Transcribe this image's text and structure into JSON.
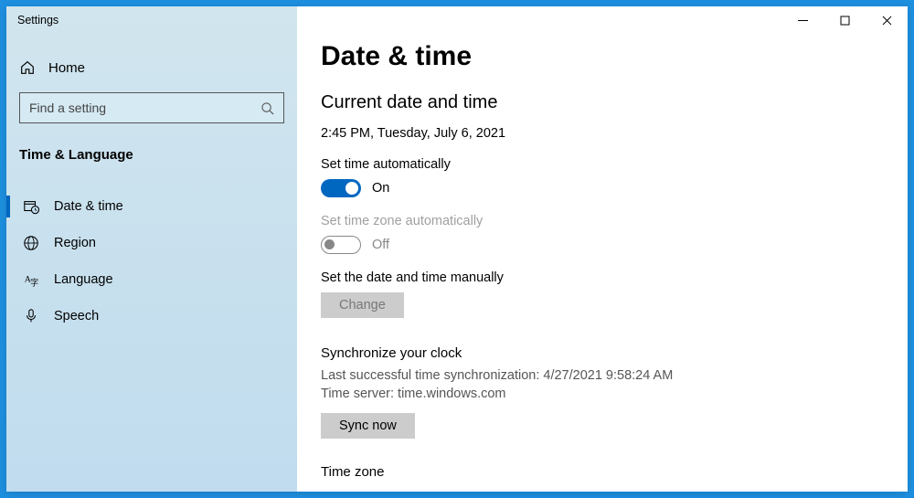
{
  "window": {
    "title": "Settings"
  },
  "sidebar": {
    "home": "Home",
    "search_placeholder": "Find a setting",
    "category": "Time & Language",
    "items": [
      {
        "label": "Date & time"
      },
      {
        "label": "Region"
      },
      {
        "label": "Language"
      },
      {
        "label": "Speech"
      }
    ]
  },
  "main": {
    "title": "Date & time",
    "current_heading": "Current date and time",
    "current_value": "2:45 PM, Tuesday, July 6, 2021",
    "auto_time_label": "Set time automatically",
    "auto_time_state": "On",
    "auto_tz_label": "Set time zone automatically",
    "auto_tz_state": "Off",
    "manual_label": "Set the date and time manually",
    "change_btn": "Change",
    "sync_heading": "Synchronize your clock",
    "sync_last": "Last successful time synchronization: 4/27/2021 9:58:24 AM",
    "sync_server": "Time server: time.windows.com",
    "sync_btn": "Sync now",
    "tz_heading": "Time zone"
  }
}
